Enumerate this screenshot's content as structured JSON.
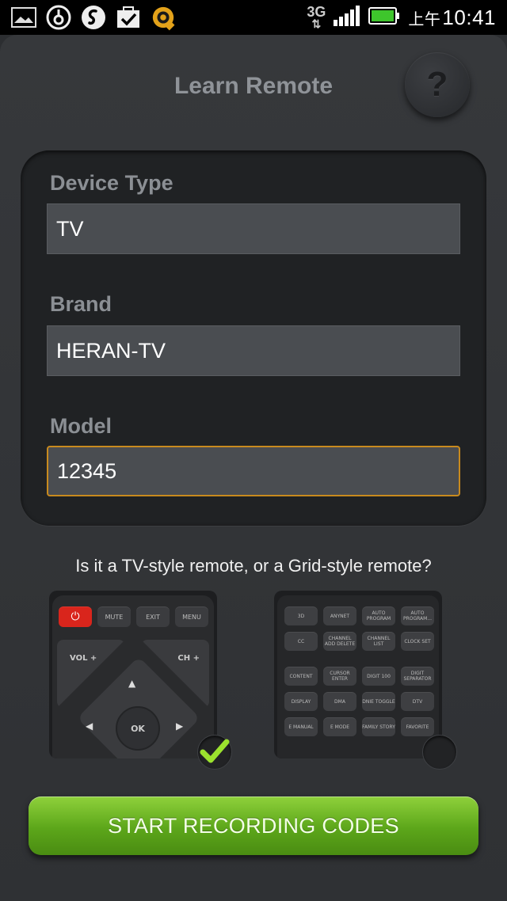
{
  "status_bar": {
    "time_prefix": "上午",
    "time": "10:41",
    "network": "3G",
    "icons": [
      "gallery-icon",
      "bittorrent-icon",
      "shazam-icon",
      "task-check-icon",
      "qq-icon"
    ],
    "battery_color": "#3ec62c"
  },
  "header": {
    "title": "Learn Remote",
    "help_label": "?"
  },
  "form": {
    "device_type_label": "Device Type",
    "device_type_value": "TV",
    "brand_label": "Brand",
    "brand_value": "HERAN-TV",
    "model_label": "Model",
    "model_value": "12345"
  },
  "remote_style": {
    "question": "Is it a TV-style remote, or a Grid-style remote?",
    "selected": "tv",
    "tv_preview": {
      "top_buttons": [
        "⏻",
        "MUTE",
        "EXIT",
        "MENU"
      ],
      "vol_label": "VOL +",
      "ch_label": "CH +",
      "ok_label": "OK"
    },
    "grid_preview": {
      "buttons": [
        "3D",
        "ANYNET",
        "AUTO PROGRAM",
        "AUTO PROGRAM...",
        "CC",
        "CHANNEL ADD DELETE",
        "CHANNEL LIST",
        "CLOCK SET",
        "CONTENT",
        "CURSOR ENTER",
        "DIGIT 100",
        "DIGIT SEPARATOR",
        "DISPLAY",
        "DMA",
        "DNIE TOGGLE",
        "DTV",
        "E MANUAL",
        "E MODE",
        "FAMILY STORY",
        "FAVORITE"
      ]
    }
  },
  "start_button": {
    "label": "START RECORDING CODES"
  },
  "colors": {
    "accent_green": "#5ca61a",
    "focus_orange": "#c88a1e",
    "power_red": "#d9251c"
  }
}
